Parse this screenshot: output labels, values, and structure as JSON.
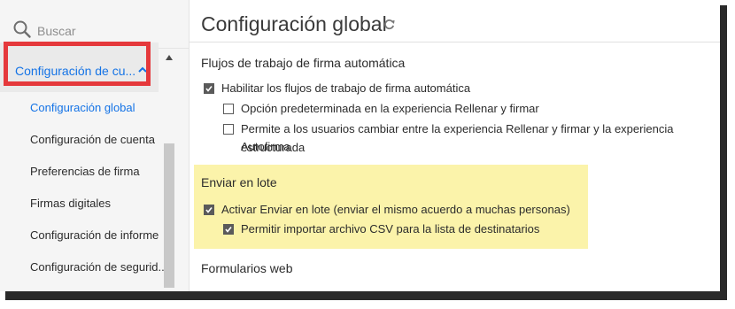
{
  "search": {
    "placeholder": "Buscar"
  },
  "sidebar": {
    "selected_label": "Configuración de cu...",
    "items": [
      {
        "label": "Configuración global",
        "active": true
      },
      {
        "label": "Configuración de cuenta"
      },
      {
        "label": "Preferencias de firma"
      },
      {
        "label": "Firmas digitales"
      },
      {
        "label": "Configuración de informe"
      },
      {
        "label": "Configuración de segurid..."
      }
    ]
  },
  "main": {
    "title": "Configuración global",
    "sections": {
      "auto_sign": {
        "title": "Flujos de trabajo de firma automática",
        "enable_label": "Habilitar los flujos de trabajo de firma automática",
        "enable_checked": true,
        "default_label": "Opción predeterminada en la experiencia Rellenar y firmar",
        "default_checked": false,
        "allow_label_line1": "Permite a los usuarios cambiar entre la experiencia Rellenar y firmar y la experiencia Autofirma",
        "allow_label_line2": "estructurada",
        "allow_checked": false
      },
      "bulk": {
        "title": "Enviar en lote",
        "activate_label": "Activar Enviar en lote (enviar el mismo acuerdo a muchas personas)",
        "activate_checked": true,
        "csv_label": "Permitir importar archivo CSV para la lista de destinatarios",
        "csv_checked": true
      },
      "web_forms": {
        "title": "Formularios web"
      }
    }
  },
  "colors": {
    "accent": "#1473e6",
    "callout_border": "#e5393c",
    "highlight": "#fbf3aa"
  }
}
